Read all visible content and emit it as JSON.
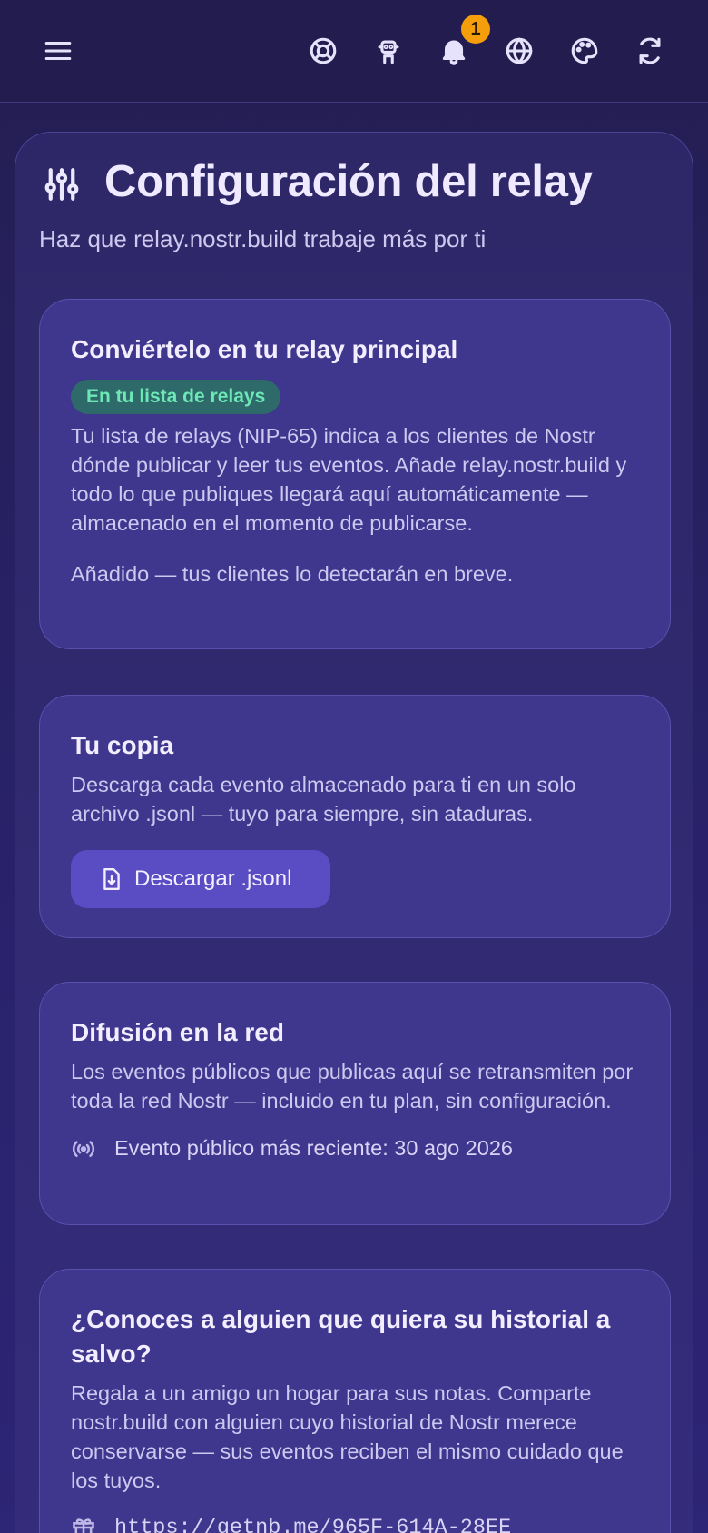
{
  "header": {
    "notification_count": "1",
    "icons": [
      "menu-icon",
      "lifebuoy-icon",
      "robot-icon",
      "bell-icon",
      "globe-icon",
      "palette-icon",
      "refresh-icon"
    ]
  },
  "page": {
    "title": "Configuración del relay",
    "subtitle": "Haz que relay.nostr.build trabaje más por ti"
  },
  "cards": {
    "primary": {
      "title": "Conviértelo en tu relay principal",
      "status_pill": "En tu lista de relays",
      "description": "Tu lista de relays (NIP-65) indica a los clientes de Nostr dónde publicar y leer tus eventos. Añade relay.nostr.build y todo lo que publiques llegará aquí automáticamente — almacenado en el momento de publicarse.",
      "note": "Añadido — tus clientes lo detectarán en breve."
    },
    "copy": {
      "title": "Tu copia",
      "description": "Descarga cada evento almacenado para ti en un solo archivo .jsonl — tuyo para siempre, sin ataduras.",
      "button_label": "Descargar .jsonl"
    },
    "broadcast": {
      "title": "Difusión en la red",
      "description": "Los eventos públicos que publicas aquí se retransmiten por toda la red Nostr — incluido en tu plan, sin configuración.",
      "latest_event": "Evento público más reciente: 30 ago 2026"
    },
    "referral": {
      "title": "¿Conoces a alguien que quiera su historial a salvo?",
      "description": "Regala a un amigo un hogar para sus notas. Comparte nostr.build con alguien cuyo historial de Nostr merece conservarse — sus eventos reciben el mismo cuidado que los tuyos.",
      "link": "https://getnb.me/965F-614A-28EE"
    }
  },
  "colors": {
    "background": "#231c4f",
    "card": "#3f368e",
    "accent_button": "#5a4cc2",
    "pill_text": "#6ee7b7",
    "badge": "#f59e0b"
  }
}
